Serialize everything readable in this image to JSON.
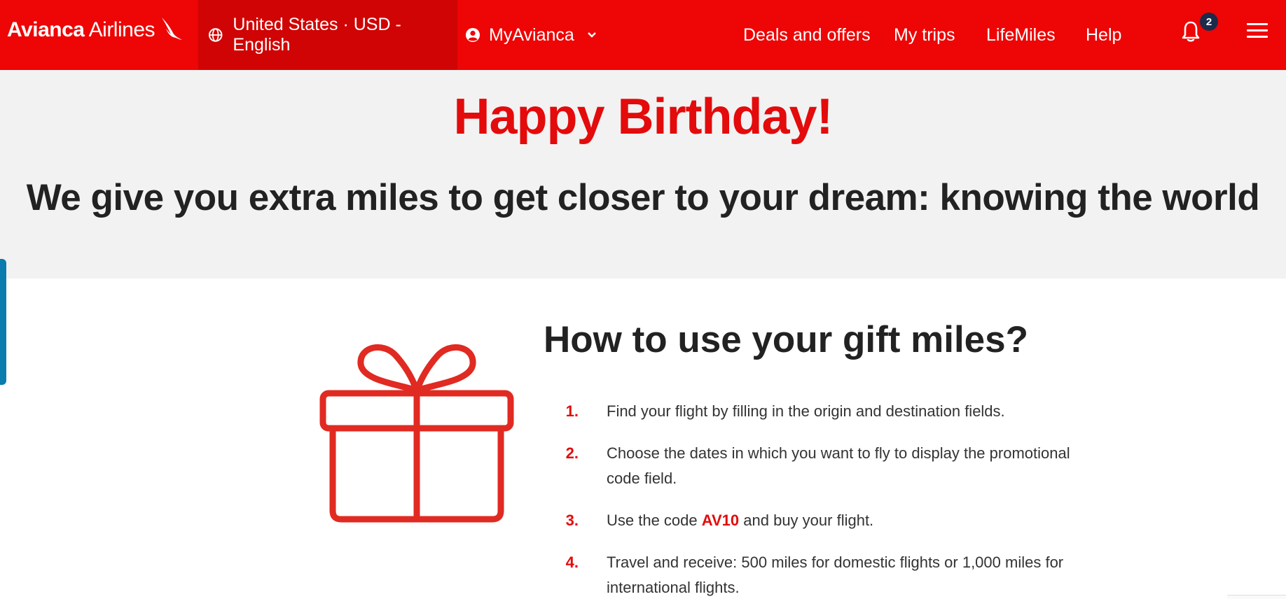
{
  "header": {
    "logo_brand": "Avianca",
    "logo_suffix": "Airlines",
    "locale_label": "United States · USD - English",
    "account_label": "MyAvianca",
    "nav": [
      "Deals and offers",
      "My trips",
      "LifeMiles",
      "Help"
    ],
    "notification_count": "2",
    "colors": {
      "header_bg": "#ee0505",
      "locale_bg": "#d00404"
    },
    "icons": [
      "globe-icon",
      "user-icon",
      "chevron-down-icon",
      "bell-icon",
      "menu-icon"
    ]
  },
  "hero": {
    "title": "Happy Birthday!",
    "subtitle": "We give you extra miles to get closer to your dream: knowing the world"
  },
  "main": {
    "heading": "How to use your gift miles?",
    "steps": [
      {
        "num": "1.",
        "text": "Find your flight by filling in the origin and destination fields."
      },
      {
        "num": "2.",
        "text": "Choose the dates in which you want to fly to display the promotional code field."
      },
      {
        "num": "3.",
        "before": "Use the code ",
        "code": "AV10",
        "after": " and buy your flight."
      },
      {
        "num": "4.",
        "text": "Travel and receive: 500 miles for domestic flights or 1,000 miles for international flights."
      }
    ],
    "gift_icon": "gift-icon",
    "accent_color": "#e30b0b"
  }
}
